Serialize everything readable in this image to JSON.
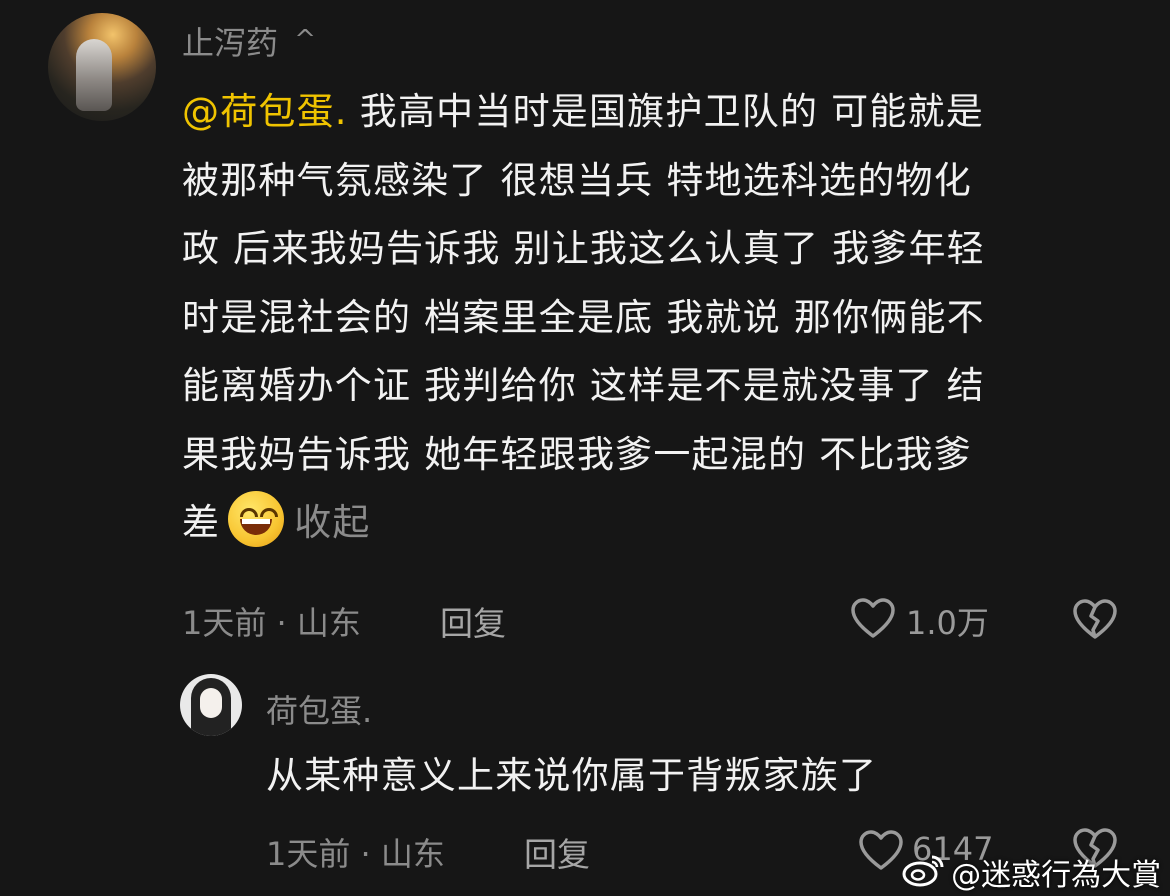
{
  "comment": {
    "username": "止泻药",
    "expand_glyph": "^",
    "mention": "@荷包蛋.",
    "lines": [
      "我高中当时是国旗护卫队的 可能就是",
      "被那种气氛感染了 很想当兵 特地选科选的物化",
      "政 后来我妈告诉我 别让我这么认真了 我爹年轻",
      "时是混社会的 档案里全是底 我就说 那你俩能不",
      "能离婚办个证 我判给你 这样是不是就没事了 结",
      "果我妈告诉我 她年轻跟我爹一起混的 不比我爹",
      "差"
    ],
    "emoji": "grinning-sweat-face",
    "collapse_label": "收起",
    "meta": "1天前 · 山东",
    "reply_label": "回复",
    "like_count": "1.0万"
  },
  "reply": {
    "username": "荷包蛋.",
    "text": "从某种意义上来说你属于背叛家族了",
    "meta": "1天前 · 山东",
    "reply_label": "回复",
    "like_count": "6147"
  },
  "watermark": "@迷惑行為大賞",
  "icons": {
    "like": "heart-outline-icon",
    "dislike": "broken-heart-icon",
    "weibo": "weibo-logo-icon"
  },
  "colors": {
    "background": "#161616",
    "mention": "#f0c400",
    "secondary_text": "#8b8b8b"
  }
}
